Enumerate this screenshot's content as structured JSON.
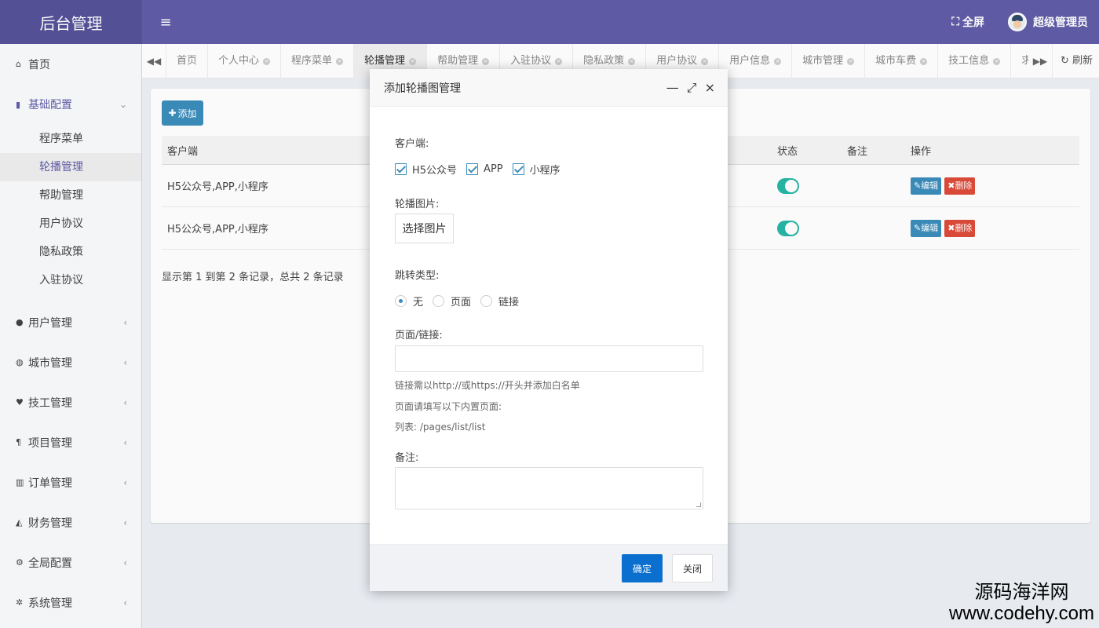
{
  "brand": "后台管理",
  "header": {
    "menu_icon": "≡",
    "fullscreen": "全屏",
    "user_name": "超级管理员"
  },
  "sidebar": {
    "home": "首页",
    "basic_config": "基础配置",
    "basic_sub": [
      "程序菜单",
      "轮播管理",
      "帮助管理",
      "用户协议",
      "隐私政策",
      "入驻协议"
    ],
    "groups": [
      "用户管理",
      "城市管理",
      "技工管理",
      "项目管理",
      "订单管理",
      "财务管理",
      "全局配置",
      "系统管理"
    ]
  },
  "tabs": [
    "首页",
    "个人中心",
    "程序菜单",
    "轮播管理",
    "帮助管理",
    "入驻协议",
    "隐私政策",
    "用户协议",
    "用户信息",
    "城市管理",
    "城市车费",
    "技工信息",
    "求救报警"
  ],
  "tab_refresh": "刷新",
  "content": {
    "add_label": "添加",
    "columns": {
      "client": "客户端",
      "status": "状态",
      "remark": "备注",
      "ops": "操作"
    },
    "rows": [
      {
        "client": "H5公众号,APP,小程序",
        "edit": "编辑",
        "delete": "删除"
      },
      {
        "client": "H5公众号,APP,小程序",
        "edit": "编辑",
        "delete": "删除"
      }
    ],
    "page_info": "显示第 1 到第 2 条记录，总共 2 条记录"
  },
  "modal": {
    "title": "添加轮播图管理",
    "client_label": "客户端:",
    "client_options": [
      "H5公众号",
      "APP",
      "小程序"
    ],
    "image_label": "轮播图片:",
    "pick_image": "选择图片",
    "jump_label": "跳转类型:",
    "jump_options": [
      "无",
      "页面",
      "链接"
    ],
    "link_label": "页面/链接:",
    "hint1": "链接需以http://或https://开头并添加白名单",
    "hint2": "页面请填写以下内置页面:",
    "hint3": "列表: /pages/list/list",
    "remark_label": "备注:",
    "ok": "确定",
    "close": "关闭"
  },
  "watermark": {
    "line1": "源码海洋网",
    "line2": "www.codehy.com"
  }
}
